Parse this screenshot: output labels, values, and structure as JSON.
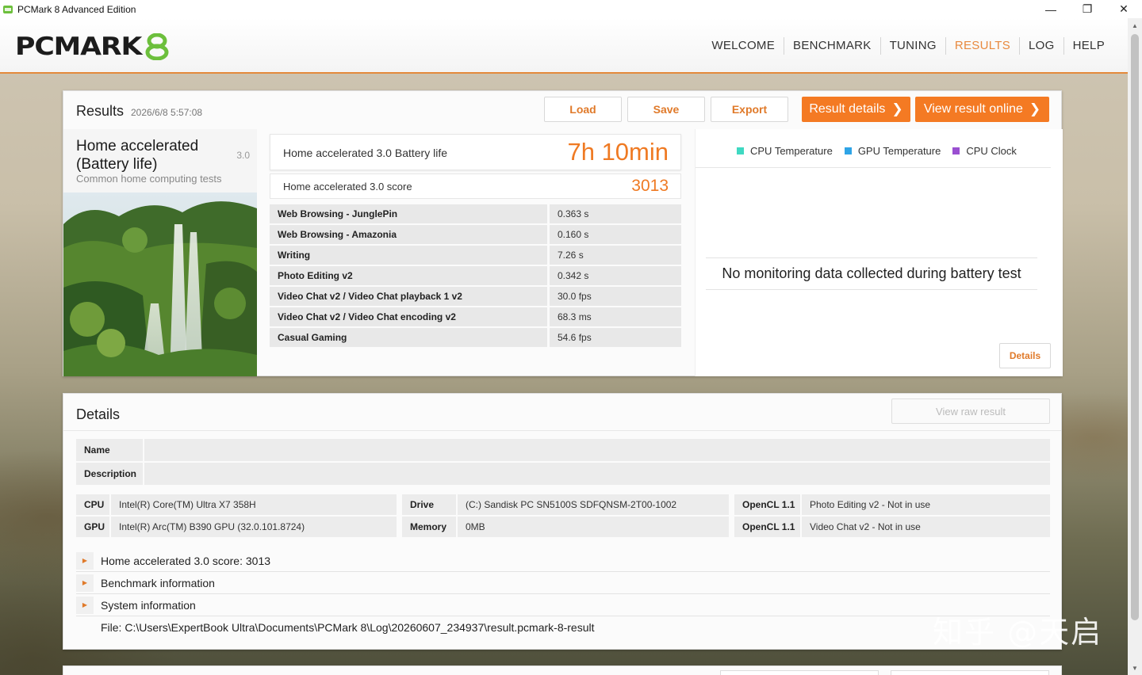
{
  "window": {
    "title": "PCMark 8 Advanced Edition",
    "minimize": "—",
    "maximize": "❐",
    "close": "✕"
  },
  "logo": {
    "text": "PCMARK",
    "mark": "8"
  },
  "nav": {
    "items": [
      "WELCOME",
      "BENCHMARK",
      "TUNING",
      "RESULTS",
      "LOG",
      "HELP"
    ],
    "active": "RESULTS"
  },
  "results": {
    "title": "Results",
    "date": "2026/6/8 5:57:08",
    "buttons": {
      "load": "Load",
      "save": "Save",
      "export": "Export",
      "result_details": "Result details",
      "view_online": "View result online",
      "chevron": "❯"
    },
    "benchmark": {
      "name": "Home accelerated (Battery life)",
      "version": "3.0",
      "subtitle": "Common home computing tests"
    },
    "battery": {
      "label": "Home accelerated 3.0 Battery life",
      "value": "7h 10min"
    },
    "score": {
      "label": "Home accelerated 3.0 score",
      "value": "3013"
    },
    "subtests": [
      {
        "name": "Web Browsing - JunglePin",
        "value": "0.363 s"
      },
      {
        "name": "Web Browsing - Amazonia",
        "value": "0.160 s"
      },
      {
        "name": "Writing",
        "value": "7.26 s"
      },
      {
        "name": "Photo Editing v2",
        "value": "0.342 s"
      },
      {
        "name": "Video Chat v2 / Video Chat playback 1 v2",
        "value": "30.0 fps"
      },
      {
        "name": "Video Chat v2 / Video Chat encoding v2",
        "value": "68.3 ms"
      },
      {
        "name": "Casual Gaming",
        "value": "54.6 fps"
      }
    ],
    "monitoring": {
      "legend": [
        {
          "label": "CPU Temperature",
          "color": "#3fd9c2"
        },
        {
          "label": "GPU Temperature",
          "color": "#2fa4e6"
        },
        {
          "label": "CPU Clock",
          "color": "#9a4fd1"
        }
      ],
      "message": "No monitoring data collected during battery test",
      "details_button": "Details"
    }
  },
  "details": {
    "title": "Details",
    "view_raw": "View raw result",
    "name_label": "Name",
    "description_label": "Description",
    "hardware": [
      [
        {
          "key": "CPU",
          "value": "Intel(R) Core(TM) Ultra X7 358H"
        },
        {
          "key": "Drive",
          "value": "(C:) Sandisk PC SN5100S SDFQNSM-2T00-1002"
        },
        {
          "key": "OpenCL 1.1",
          "value": "Photo Editing v2 - Not in use"
        }
      ],
      [
        {
          "key": "GPU",
          "value": "Intel(R) Arc(TM) B390 GPU (32.0.101.8724)"
        },
        {
          "key": "Memory",
          "value": "0MB"
        },
        {
          "key": "OpenCL 1.1",
          "value": "Video Chat v2 - Not in use"
        }
      ]
    ],
    "tree": [
      "Home accelerated 3.0 score: 3013",
      "Benchmark information",
      "System information"
    ],
    "tree_toggle": "▶",
    "file": "File: C:\\Users\\ExpertBook Ultra\\Documents\\PCMark 8\\Log\\20260607_234937\\result.pcmark-8-result"
  },
  "watermark": "知乎 @天启",
  "scroll": {
    "up": "▲",
    "down": "▼"
  }
}
